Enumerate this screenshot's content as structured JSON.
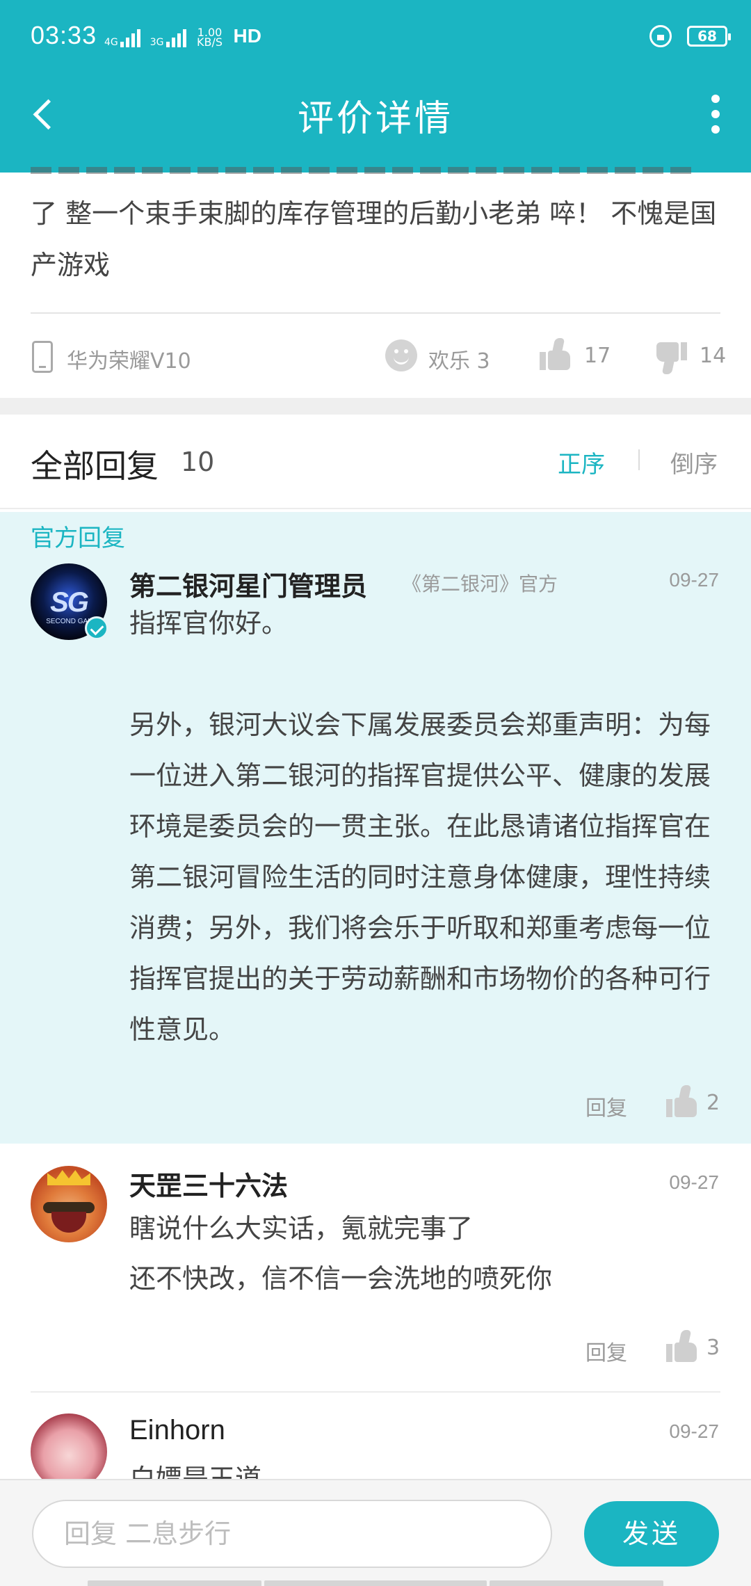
{
  "status_bar": {
    "time": "03:33",
    "net_speed": "1.00\nKB/S",
    "net_1": "4G",
    "net_2": "3G",
    "hd": "HD",
    "battery": "68"
  },
  "header": {
    "title": "评价详情"
  },
  "review": {
    "text": "了 整一个束手束脚的库存管理的后勤小老弟 啐！ 不愧是国产游戏",
    "device": "华为荣耀V10",
    "mood_label": "欢乐 3",
    "likes": "17",
    "dislikes": "14"
  },
  "replies_header": {
    "title": "全部回复",
    "count": "10",
    "sort_asc": "正序",
    "sort_desc": "倒序"
  },
  "official_reply": {
    "tag": "官方回复",
    "author": "第二银河星门管理员",
    "author_sub": "《第二银河》官方",
    "date": "09-27",
    "avatar_text": "SG",
    "avatar_sub": "SECOND GAL",
    "paragraphs": [
      "指挥官你好。",
      "另外，银河大议会下属发展委员会郑重声明：为每一位进入第二银河的指挥官提供公平、健康的发展环境是委员会的一贯主张。在此恳请诸位指挥官在第二银河冒险生活的同时注意身体健康，理性持续消费；另外，我们将会乐于听取和郑重考虑每一位指挥官提出的关于劳动薪酬和市场物价的各种可行性意见。"
    ],
    "reply_label": "回复",
    "likes": "2"
  },
  "reply_2": {
    "author": "天罡三十六法",
    "date": "09-27",
    "lines": [
      "瞎说什么大实话，氪就完事了",
      "还不快改，信不信一会洗地的喷死你"
    ],
    "reply_label": "回复",
    "likes": "3"
  },
  "reply_3": {
    "author": "Einhorn",
    "date": "09-27",
    "line": "白嫖是王道"
  },
  "bottom_bar": {
    "input_placeholder": "回复 二息步行",
    "send_label": "发送"
  },
  "colors": {
    "accent": "#1BB5C2",
    "official_bg": "#E4F6F8"
  }
}
